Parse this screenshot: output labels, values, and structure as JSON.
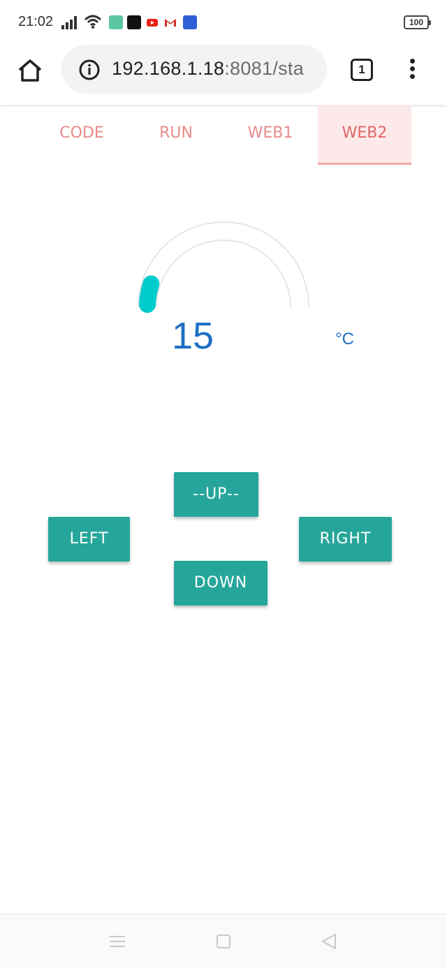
{
  "status_bar": {
    "time": "21:02",
    "battery": "100",
    "icons": [
      "signal-icon",
      "wifi-icon",
      "app-icon",
      "tiktok-icon",
      "youtube-icon",
      "gmail-icon",
      "news-app-icon"
    ]
  },
  "browser": {
    "url_host": "192.168.1.18",
    "url_rest": ":8081/sta",
    "tab_count": "1"
  },
  "tabs": [
    {
      "label": "CODE",
      "active": false
    },
    {
      "label": "RUN",
      "active": false
    },
    {
      "label": "WEB1",
      "active": false
    },
    {
      "label": "WEB2",
      "active": true
    }
  ],
  "gauge": {
    "value": "15",
    "unit": "°C",
    "fraction": 0.1,
    "fill_color": "#00cccc",
    "track_color": "#e0e0e0"
  },
  "controls": {
    "up": "--UP--",
    "left": "LEFT",
    "right": "RIGHT",
    "down": "DOWN",
    "button_color": "#26a69a"
  },
  "navbar": {
    "icons": [
      "menu-icon",
      "home-square-icon",
      "back-triangle-icon"
    ]
  }
}
